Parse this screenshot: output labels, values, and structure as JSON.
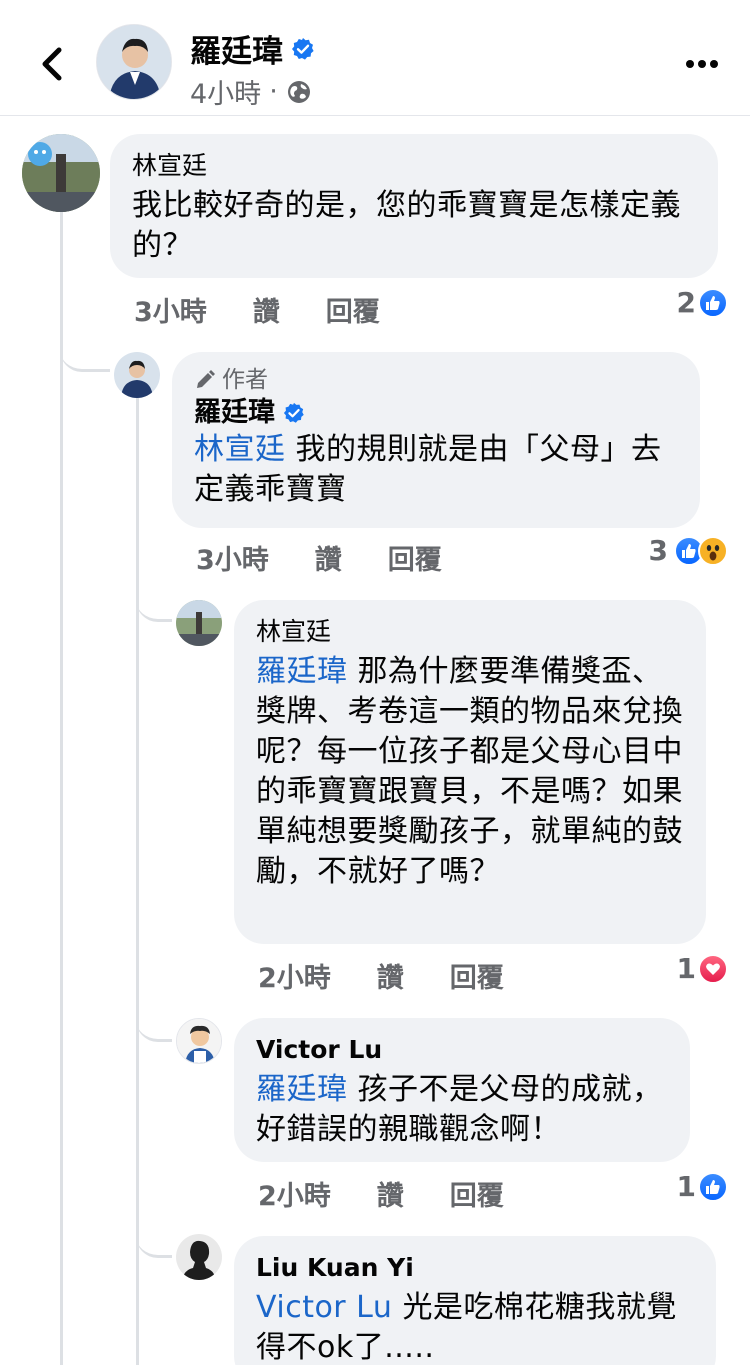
{
  "header": {
    "author_name": "羅廷瑋",
    "time": "4小時",
    "separator": "·"
  },
  "comments": [
    {
      "name": "林宣廷",
      "mention": "",
      "text": "我比較好奇的是，您的乖寶寶是怎樣定義的？",
      "time": "3小時",
      "like_label": "讚",
      "reply_label": "回覆",
      "reaction_count": "2",
      "reactions": [
        "like-icon"
      ]
    },
    {
      "author_tag": "作者",
      "name": "羅廷瑋",
      "mention": "林宣廷",
      "text": "我的規則就是由「父母」去定義乖寶寶",
      "time": "3小時",
      "like_label": "讚",
      "reply_label": "回覆",
      "reaction_count": "3",
      "reactions": [
        "like-icon",
        "wow-icon"
      ]
    },
    {
      "name": "林宣廷",
      "mention": "羅廷瑋",
      "text": "那為什麼要準備獎盃、獎牌、考卷這一類的物品來兌換呢？每一位孩子都是父母心目中的乖寶寶跟寶貝，不是嗎？如果單純想要獎勵孩子，就單純的鼓勵，不就好了嗎？",
      "time": "2小時",
      "like_label": "讚",
      "reply_label": "回覆",
      "reaction_count": "1",
      "reactions": [
        "love-icon"
      ]
    },
    {
      "name": "Victor Lu",
      "mention": "羅廷瑋",
      "text": "孩子不是父母的成就，好錯誤的親職觀念啊！",
      "time": "2小時",
      "like_label": "讚",
      "reply_label": "回覆",
      "reaction_count": "1",
      "reactions": [
        "like-icon"
      ]
    },
    {
      "name": "Liu Kuan Yi",
      "mention": "Victor Lu",
      "text": "光是吃棉花糖我就覺得不ok了.....",
      "time": "",
      "like_label": "",
      "reply_label": "",
      "reaction_count": "",
      "reactions": []
    }
  ]
}
